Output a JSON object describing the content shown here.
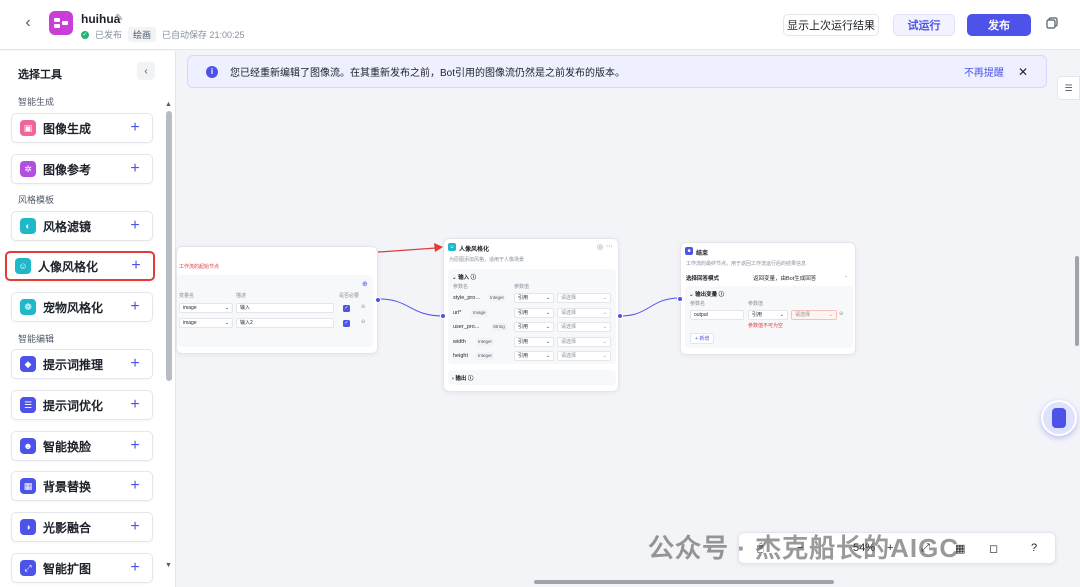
{
  "header": {
    "app_name": "huihua",
    "status": "已发布",
    "category": "绘画",
    "autosave": "已自动保存 21:00:25",
    "btn_last_result": "显示上次运行结果",
    "btn_test_run": "试运行",
    "btn_publish": "发布"
  },
  "sidebar": {
    "title": "选择工具",
    "sections": [
      {
        "label": "智能生成",
        "items": [
          {
            "label": "图像生成",
            "color": "#f0659b"
          },
          {
            "label": "图像参考",
            "color": "#b34fe0"
          }
        ]
      },
      {
        "label": "风格模板",
        "items": [
          {
            "label": "风格滤镜",
            "color": "#1fb8c9"
          },
          {
            "label": "人像风格化",
            "color": "#1fb8c9",
            "selected": true
          },
          {
            "label": "宠物风格化",
            "color": "#1fb8c9"
          }
        ]
      },
      {
        "label": "智能编辑",
        "items": [
          {
            "label": "提示词推理",
            "color": "#4d53e8"
          },
          {
            "label": "提示词优化",
            "color": "#4d53e8"
          },
          {
            "label": "智能换脸",
            "color": "#4d53e8"
          },
          {
            "label": "背景替换",
            "color": "#4d53e8"
          },
          {
            "label": "光影融合",
            "color": "#4d53e8"
          },
          {
            "label": "智能扩图",
            "color": "#4d53e8"
          }
        ]
      }
    ]
  },
  "banner": {
    "text": "您已经重新编辑了图像流。在其重新发布之前，Bot引用的图像流仍然是之前发布的版本。",
    "dismiss": "不再提醒"
  },
  "start_node": {
    "desc": "工作流的起始节点",
    "col_var": "变量名",
    "col_desc": "描述",
    "col_required": "是否必要",
    "rows": [
      {
        "name": "image",
        "desc": "输入"
      },
      {
        "name": "image",
        "desc": "输入2"
      }
    ]
  },
  "portrait_node": {
    "title": "人像风格化",
    "desc": "为原图添加风格，适用于人像场景",
    "input_label": "输入",
    "col_param": "参数名",
    "col_value": "参数值",
    "ref": "引用",
    "select_placeholder": "请选择",
    "rows": [
      {
        "name": "style_pro...",
        "type": "Integer"
      },
      {
        "name": "url*",
        "type": "Image"
      },
      {
        "name": "user_pro...",
        "type": "String"
      },
      {
        "name": "width",
        "type": "Integer"
      },
      {
        "name": "height",
        "type": "Integer"
      }
    ],
    "output_label": "输出"
  },
  "end_node": {
    "title": "结束",
    "desc": "工作流的最终节点，用于返回工作流运行后的结果信息",
    "mode_label": "选择回答模式",
    "mode_value": "返回变量，由Bot生成回答",
    "output_var_label": "输出变量",
    "col_param": "参数名",
    "col_value": "参数值",
    "row_name": "output",
    "ref": "引用",
    "select_placeholder": "请选择",
    "error": "参数值不可为空",
    "add": "新增"
  },
  "toolbar": {
    "zoom": "54%"
  },
  "watermark": "公众号 · 杰克船长的AIGC",
  "colors": {
    "accent": "#4d53e8",
    "selected_border": "#e23b3b",
    "published": "#22b573"
  }
}
